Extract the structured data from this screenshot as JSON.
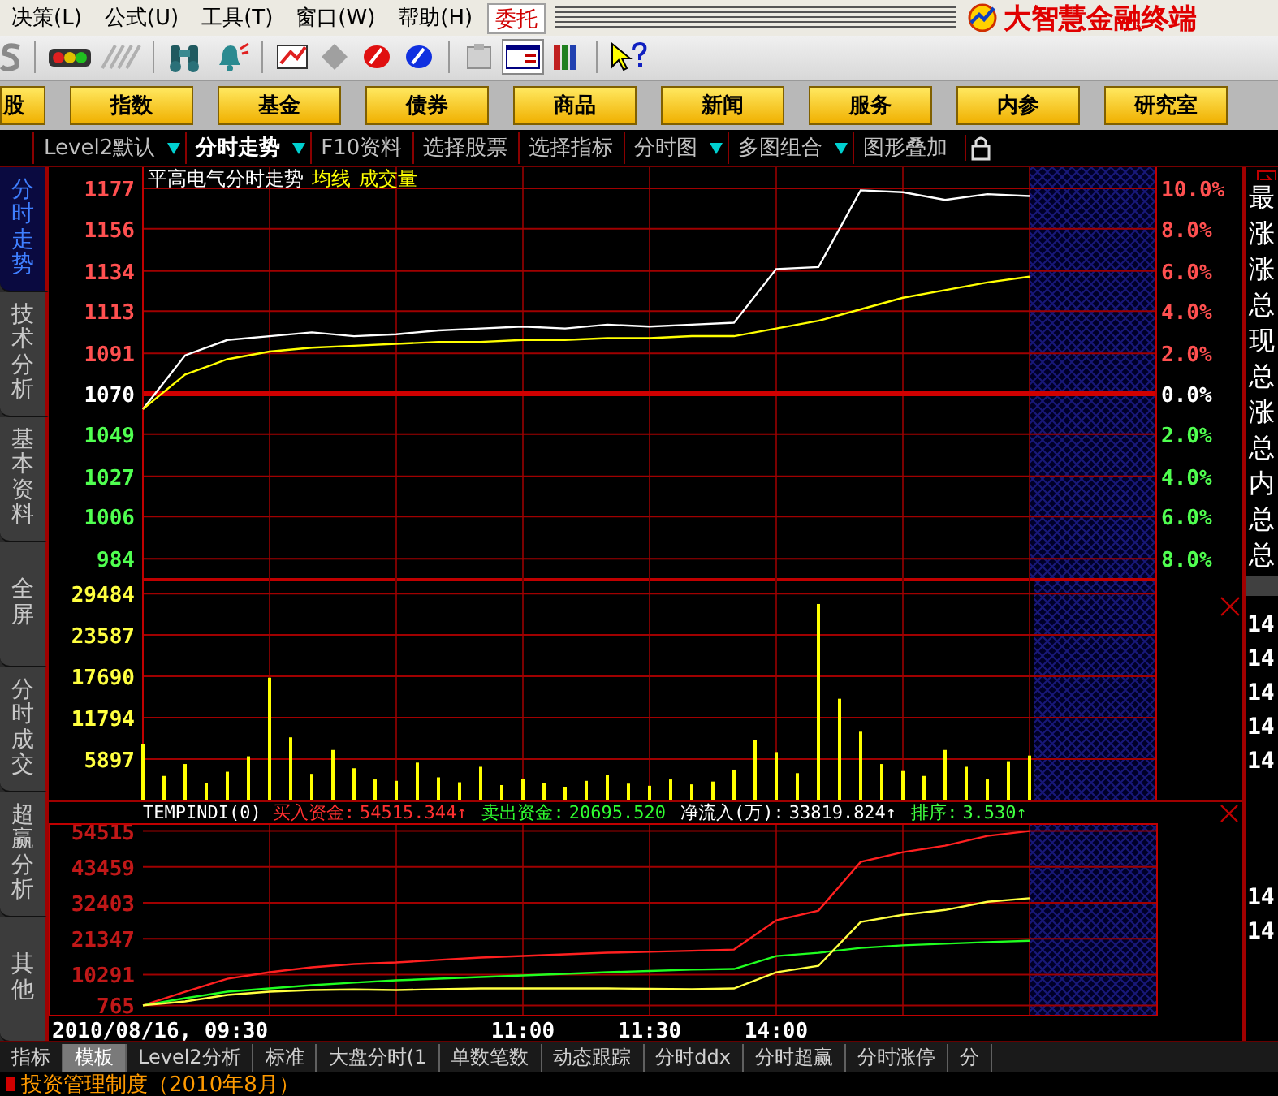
{
  "menu_bar": {
    "items": [
      "决策(L)",
      "公式(U)",
      "工具(T)",
      "窗口(W)",
      "帮助(H)"
    ],
    "trade_button": "委托",
    "brand": "大智慧金融终端"
  },
  "nav_buttons": [
    "股",
    "指数",
    "基金",
    "债券",
    "商品",
    "新闻",
    "服务",
    "内参",
    "研究室"
  ],
  "view_tabs": [
    {
      "label": "Level2默认",
      "selected": false,
      "has_menu": true
    },
    {
      "label": "分时走势",
      "selected": true,
      "has_menu": true
    },
    {
      "label": "F10资料",
      "selected": false,
      "has_menu": false
    },
    {
      "label": "选择股票",
      "selected": false,
      "has_menu": false
    },
    {
      "label": "选择指标",
      "selected": false,
      "has_menu": false
    },
    {
      "label": "分时图",
      "selected": false,
      "has_menu": true
    },
    {
      "label": "多图组合",
      "selected": false,
      "has_menu": true
    },
    {
      "label": "图形叠加",
      "selected": false,
      "has_menu": false
    }
  ],
  "side_tabs": [
    {
      "label": "分时走势",
      "selected": true
    },
    {
      "label": "技术分析",
      "selected": false
    },
    {
      "label": "基本资料",
      "selected": false
    },
    {
      "label": "全屏",
      "selected": false
    },
    {
      "label": "分时成交",
      "selected": false
    },
    {
      "label": "超赢分析",
      "selected": false
    },
    {
      "label": "其他",
      "selected": false
    }
  ],
  "price_chart": {
    "title": "平高电气分时走势",
    "percent_axis": [
      {
        "label": "10.0%",
        "kind": "up"
      },
      {
        "label": "8.0%",
        "kind": "up"
      },
      {
        "label": "6.0%",
        "kind": "up"
      },
      {
        "label": "4.0%",
        "kind": "up"
      },
      {
        "label": "2.0%",
        "kind": "up"
      },
      {
        "label": "0.0%",
        "kind": "flat"
      },
      {
        "label": "2.0%",
        "kind": "down"
      },
      {
        "label": "4.0%",
        "kind": "down"
      },
      {
        "label": "6.0%",
        "kind": "down"
      },
      {
        "label": "8.0%",
        "kind": "down"
      }
    ],
    "chart_data": {
      "type": "line",
      "ylim": [
        974,
        1188
      ],
      "grid": true,
      "ref_lines": [
        {
          "axis": "y",
          "value": 1070
        }
      ],
      "yticks": [
        1177,
        1156,
        1134,
        1113,
        1091,
        1070,
        1049,
        1027,
        1006,
        984
      ],
      "series": [
        {
          "color": "#ffffff",
          "values": [
            1062,
            1090,
            1098,
            1100,
            1102,
            1100,
            1101,
            1103,
            1104,
            1105,
            1104,
            1106,
            1105,
            1106,
            1107,
            1135,
            1136,
            1176,
            1175,
            1171,
            1174,
            1173,
            null,
            null,
            null
          ]
        },
        {
          "name": "均线",
          "color": "#ffff00",
          "values": [
            1062,
            1080,
            1088,
            1092,
            1094,
            1095,
            1096,
            1097,
            1097,
            1098,
            1098,
            1099,
            1099,
            1100,
            1100,
            1104,
            1108,
            1114,
            1120,
            1124,
            1128,
            1131,
            null,
            null,
            null
          ]
        }
      ]
    }
  },
  "volume_chart": {
    "chart_data": {
      "type": "bar",
      "ylim": [
        0,
        31700
      ],
      "grid": true,
      "yticks": [
        29484,
        23587,
        17690,
        11794,
        5897
      ],
      "series": [
        {
          "name": "成交量",
          "color": "#ffff00",
          "values": [
            8000,
            3500,
            5200,
            2500,
            4100,
            6300,
            17500,
            9000,
            3800,
            7200,
            4600,
            3000,
            2800,
            5400,
            3300,
            2600,
            4800,
            2200,
            3100,
            2500,
            1900,
            2800,
            3600,
            2400,
            2100,
            3000,
            2300,
            2700,
            4400,
            8600,
            6900,
            3900,
            28000,
            14500,
            9800,
            5200,
            4200,
            3500,
            7200,
            4800,
            3000,
            5600,
            6400,
            null,
            null,
            null,
            null,
            null,
            null
          ]
        }
      ]
    }
  },
  "flow_indicator": {
    "name": "TEMPINDI(0)",
    "items": [
      {
        "label": "买入资金:",
        "value": "54515.344↑",
        "color": "#ff3030"
      },
      {
        "label": "卖出资金:",
        "value": "20695.520",
        "color": "#30ff30"
      },
      {
        "label": "净流入(万):",
        "value": "33819.824↑",
        "color": "#ffffff"
      },
      {
        "label": "排序:",
        "value": "3.530↑",
        "color": "#40ff40"
      }
    ]
  },
  "flow_chart": {
    "chart_data": {
      "type": "line",
      "ylim": [
        -2119,
        56918
      ],
      "grid": true,
      "categories": [
        "2010/08/16, 09:30",
        null,
        null,
        null,
        null,
        null,
        null,
        null,
        null,
        "11:00",
        null,
        null,
        "11:30",
        null,
        null,
        "14:00",
        null,
        null,
        null,
        null,
        null,
        null,
        null,
        null,
        null
      ],
      "yticks": [
        54515,
        43459,
        32403,
        21347,
        10291,
        765
      ],
      "series": [
        {
          "color": "#ff2020",
          "values": [
            800,
            5000,
            9000,
            11000,
            12500,
            13500,
            14000,
            14800,
            15500,
            16000,
            16500,
            17000,
            17300,
            17600,
            18000,
            27000,
            30000,
            45000,
            48000,
            50000,
            53000,
            54500,
            null,
            null,
            null
          ]
        },
        {
          "color": "#20ff20",
          "values": [
            800,
            3000,
            5000,
            6000,
            7000,
            7800,
            8500,
            9000,
            9500,
            10000,
            10500,
            11000,
            11400,
            11800,
            12000,
            16000,
            17000,
            18500,
            19300,
            19800,
            20300,
            20700,
            null,
            null,
            null
          ]
        },
        {
          "color": "#ffff40",
          "values": [
            800,
            2000,
            4000,
            5000,
            5500,
            5700,
            5500,
            5800,
            6000,
            6000,
            6000,
            6000,
            5900,
            5800,
            6000,
            11000,
            13000,
            26500,
            28700,
            30200,
            32700,
            33800,
            null,
            null,
            null
          ]
        }
      ]
    }
  },
  "info_panel": {
    "labels": [
      "最",
      "涨",
      "涨",
      "总",
      "现",
      "总",
      "涨",
      "总",
      "内",
      "总",
      "总"
    ],
    "time_groups": [
      [
        "14",
        "14",
        "14",
        "14",
        "14"
      ],
      [
        "14",
        "14"
      ]
    ]
  },
  "bottom_tabs": [
    {
      "label": "指标",
      "selected": false
    },
    {
      "label": "模板",
      "selected": true
    },
    {
      "label": "Level2分析",
      "selected": false
    },
    {
      "label": "标准",
      "selected": false
    },
    {
      "label": "大盘分时(1",
      "selected": false
    },
    {
      "label": "单数笔数",
      "selected": false
    },
    {
      "label": "动态跟踪",
      "selected": false
    },
    {
      "label": "分时ddx",
      "selected": false
    },
    {
      "label": "分时超赢",
      "selected": false
    },
    {
      "label": "分时涨停",
      "selected": false
    },
    {
      "label": "分",
      "selected": false
    }
  ],
  "status_bar": {
    "text": "投资管理制度（2010年8月）"
  }
}
